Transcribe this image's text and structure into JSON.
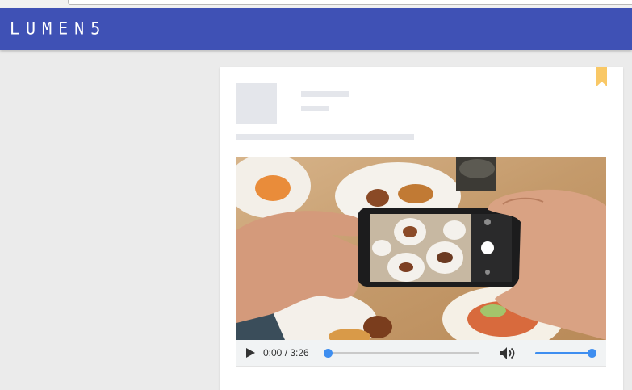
{
  "app": {
    "logo_text": "LUMEN5"
  },
  "colors": {
    "header": "#3f51b5",
    "accent": "#3e8ef0",
    "bookmark": "#f9c866"
  },
  "video": {
    "current_time": "0:00",
    "separator": " / ",
    "duration": "3:26",
    "progress_fraction": 0.02,
    "volume_fraction": 1.0
  },
  "icons": {
    "bookmark": "bookmark-icon",
    "play": "play-icon",
    "volume": "volume-icon"
  }
}
